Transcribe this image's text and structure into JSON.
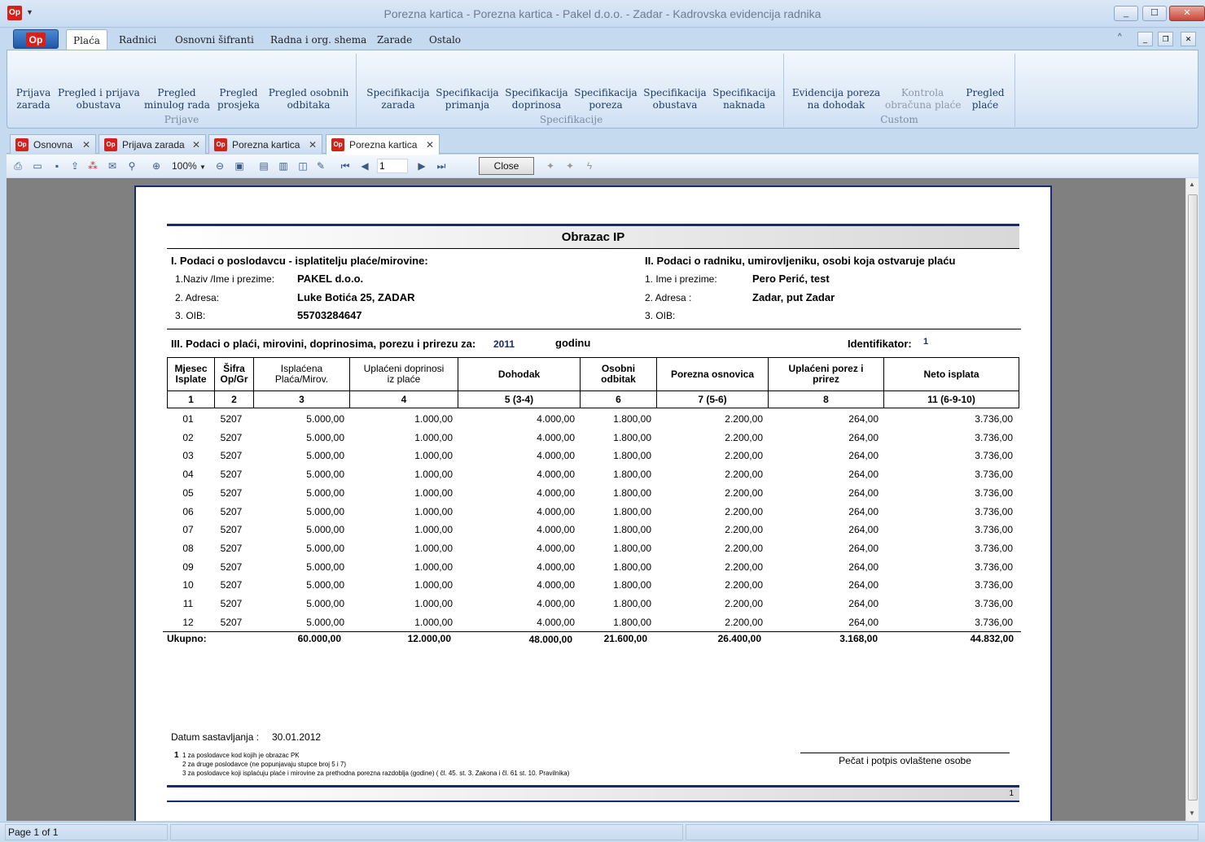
{
  "window": {
    "title": "Porezna kartica - Porezna kartica - Pakel d.o.o. - Zadar - Kadrovska evidencija radnika",
    "app_icon": "Op",
    "buttons": [
      "_",
      "☐",
      "✕"
    ]
  },
  "ribbon": {
    "tabs": [
      "Plaća",
      "Radnici",
      "Osnovni šifranti",
      "Radna i org. shema",
      "Zarade",
      "Ostalo"
    ],
    "groups": [
      {
        "label": "Prijave",
        "buttons": [
          "Prijava\nzarada",
          "Pregled i prijava\nobustava",
          "Pregled\nminulog rada",
          "Pregled\nprosjeka",
          "Pregled osobnih\nodbitaka"
        ]
      },
      {
        "label": "Specifikacije",
        "buttons": [
          "Specifikacija\nzarada",
          "Specifikacija\nprimanja",
          "Specifikacija\ndoprinosa",
          "Specifikacija\nporeza",
          "Specifikacija\nobustava",
          "Specifikacija\nnaknada"
        ]
      },
      {
        "label": "Custom",
        "buttons": [
          "Evidencija poreza\nna dohodak",
          "Kontrola\nobračuna plaće",
          "Pregled\nplaće"
        ]
      }
    ]
  },
  "doc_tabs": [
    "Osnovna",
    "Prijava zarada",
    "Porezna kartica",
    "Porezna kartica"
  ],
  "toolbar": {
    "zoom": "100%",
    "page": "1",
    "close_label": "Close"
  },
  "report": {
    "title": "Obrazac IP",
    "section1": {
      "heading": "I. Podaci o poslodavcu - isplatitelju plaće/mirovine:",
      "name_label": "1.Naziv /Ime i prezime:",
      "name": "PAKEL d.o.o.",
      "address_label": "2. Adresa:",
      "address": "Luke Botića 25, ZADAR",
      "oib_label": "3. OIB:",
      "oib": "55703284647"
    },
    "section2": {
      "heading": "II. Podaci o radniku, umirovljeniku, osobi koja ostvaruje plaću",
      "name_label": "1. Ime i prezime:",
      "name": "Pero Perić, test",
      "address_label": "2. Adresa :",
      "address": "Zadar, put Zadar",
      "oib_label": "3. OIB:"
    },
    "section3": {
      "heading": "III. Podaci o plaći, mirovini, doprinosima, porezu i prirezu za:",
      "year": "2011",
      "year_suffix": "godinu",
      "ident_label": "Identifikator:",
      "ident": "1"
    },
    "columns": [
      "Mjesec\nIsplate",
      "Šifra\nOp/Gr",
      "Isplaćena\nPlaća/Mirov.",
      "Uplaćeni doprinosi\niz plaće",
      "Dohodak",
      "Osobni\nodbitak",
      "Porezna osnovica",
      "Uplaćeni porez i\nprirez",
      "Neto isplata"
    ],
    "column_numbers": [
      "1",
      "2",
      "3",
      "4",
      "5 (3-4)",
      "6",
      "7 (5-6)",
      "8",
      "11 (6-9-10)"
    ],
    "rows": [
      [
        "01",
        "5207",
        "5.000,00",
        "1.000,00",
        "4.000,00",
        "1.800,00",
        "2.200,00",
        "264,00",
        "3.736,00"
      ],
      [
        "02",
        "5207",
        "5.000,00",
        "1.000,00",
        "4.000,00",
        "1.800,00",
        "2.200,00",
        "264,00",
        "3.736,00"
      ],
      [
        "03",
        "5207",
        "5.000,00",
        "1.000,00",
        "4.000,00",
        "1.800,00",
        "2.200,00",
        "264,00",
        "3.736,00"
      ],
      [
        "04",
        "5207",
        "5.000,00",
        "1.000,00",
        "4.000,00",
        "1.800,00",
        "2.200,00",
        "264,00",
        "3.736,00"
      ],
      [
        "05",
        "5207",
        "5.000,00",
        "1.000,00",
        "4.000,00",
        "1.800,00",
        "2.200,00",
        "264,00",
        "3.736,00"
      ],
      [
        "06",
        "5207",
        "5.000,00",
        "1.000,00",
        "4.000,00",
        "1.800,00",
        "2.200,00",
        "264,00",
        "3.736,00"
      ],
      [
        "07",
        "5207",
        "5.000,00",
        "1.000,00",
        "4.000,00",
        "1.800,00",
        "2.200,00",
        "264,00",
        "3.736,00"
      ],
      [
        "08",
        "5207",
        "5.000,00",
        "1.000,00",
        "4.000,00",
        "1.800,00",
        "2.200,00",
        "264,00",
        "3.736,00"
      ],
      [
        "09",
        "5207",
        "5.000,00",
        "1.000,00",
        "4.000,00",
        "1.800,00",
        "2.200,00",
        "264,00",
        "3.736,00"
      ],
      [
        "10",
        "5207",
        "5.000,00",
        "1.000,00",
        "4.000,00",
        "1.800,00",
        "2.200,00",
        "264,00",
        "3.736,00"
      ],
      [
        "11",
        "5207",
        "5.000,00",
        "1.000,00",
        "4.000,00",
        "1.800,00",
        "2.200,00",
        "264,00",
        "3.736,00"
      ],
      [
        "12",
        "5207",
        "5.000,00",
        "1.000,00",
        "4.000,00",
        "1.800,00",
        "2.200,00",
        "264,00",
        "3.736,00"
      ]
    ],
    "totals": {
      "label": "Ukupno:",
      "values": [
        "60.000,00",
        "12.000,00",
        "48.000,00",
        "21.600,00",
        "26.400,00",
        "3.168,00",
        "44.832,00"
      ]
    },
    "date_label": "Datum sastavljanja :",
    "date": "30.01.2012",
    "footnote_marker": "1",
    "footnotes": [
      "1  za poslodavce kod kojih je obrazac PK",
      "2  za druge poslodavce (ne popunjavaju stupce broj 5 i 7)",
      "3  za poslodavce koji isplaćuju plaće i mirovine za prethodna porezna razdoblja (godine) ( čl. 45. st. 3. Zakona i čl. 61 st. 10. Pravilnika)"
    ],
    "signature_label": "Pečat i potpis ovlaštene osobe",
    "page_number": "1"
  },
  "status": {
    "page_info": "Page 1 of 1"
  }
}
